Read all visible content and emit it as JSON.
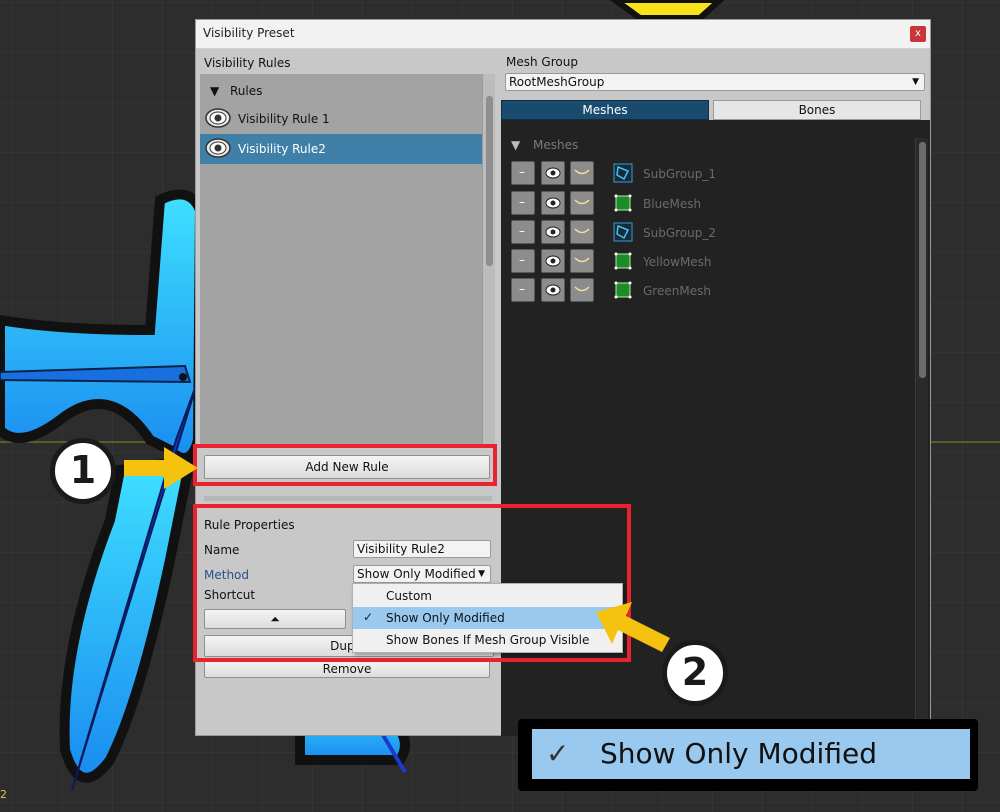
{
  "window": {
    "title": "Visibility Preset",
    "close_label": "x"
  },
  "left": {
    "section_label": "Visibility Rules",
    "tree_root_arrow": "▼",
    "tree_root_label": "Rules",
    "rules": [
      {
        "label": "Visibility Rule 1",
        "selected": false
      },
      {
        "label": "Visibility Rule2",
        "selected": true
      }
    ],
    "add_button": "Add New Rule",
    "properties": {
      "heading": "Rule Properties",
      "name_label": "Name",
      "name_value": "Visibility Rule2",
      "method_label": "Method",
      "method_value": "Show Only Modified",
      "shortcut_label": "Shortcut",
      "up_arrow": "⏶",
      "duplicate_label": "Duplic",
      "remove_label": "Remove"
    }
  },
  "dropdown": {
    "options": [
      {
        "label": "Custom",
        "checked": false
      },
      {
        "label": "Show Only Modified",
        "checked": true
      },
      {
        "label": "Show Bones If Mesh Group Visible",
        "checked": false
      }
    ],
    "check_glyph": "✓"
  },
  "right": {
    "mesh_group_label": "Mesh Group",
    "mesh_group_value": "RootMeshGroup",
    "tabs": [
      {
        "label": "Meshes",
        "active": true
      },
      {
        "label": "Bones",
        "active": false
      }
    ],
    "tree_arrow": "▼",
    "tree_label": "Meshes",
    "items": [
      {
        "label": "SubGroup_1",
        "kind": "subgroup-icon"
      },
      {
        "label": "BlueMesh",
        "kind": "mesh-icon"
      },
      {
        "label": "SubGroup_2",
        "kind": "subgroup-icon"
      },
      {
        "label": "YellowMesh",
        "kind": "mesh-icon"
      },
      {
        "label": "GreenMesh",
        "kind": "mesh-icon"
      }
    ],
    "minus_glyph": "–"
  },
  "annotations": {
    "step1": "1",
    "step2": "2",
    "zoom_check": "✓",
    "zoom_text": "Show Only Modified",
    "accent_red": "#e8232d",
    "accent_yellow": "#f5c30f"
  },
  "canvas": {
    "axis_tick": "2"
  }
}
